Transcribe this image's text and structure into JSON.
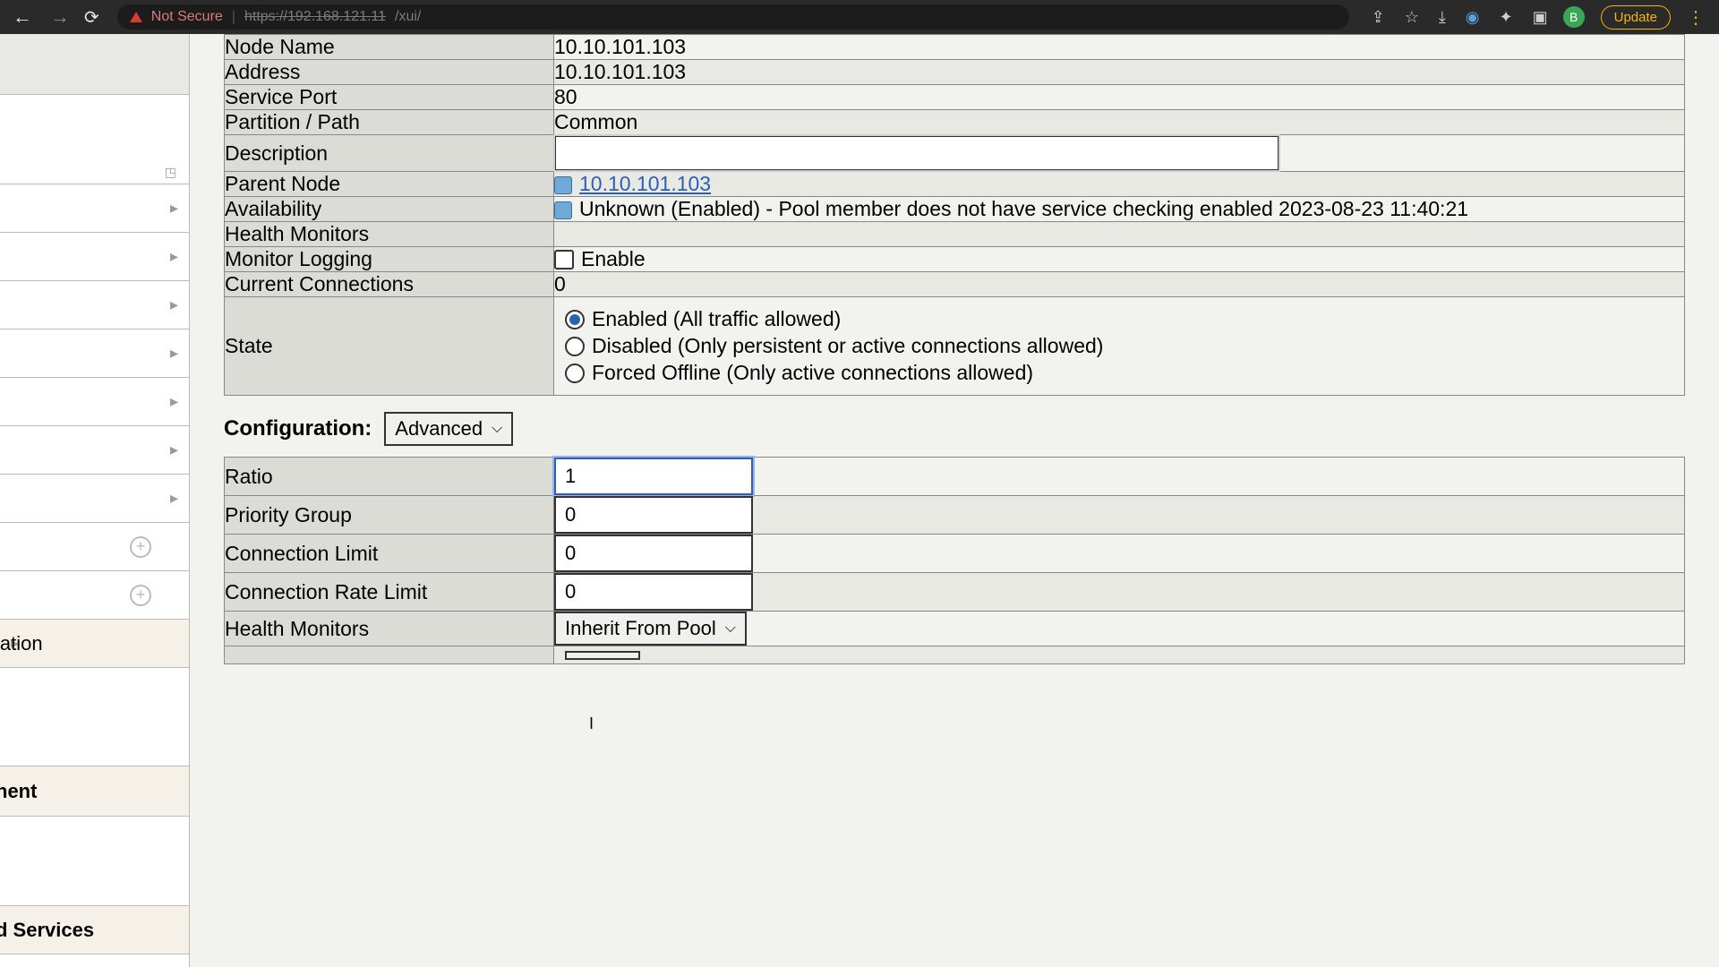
{
  "browser": {
    "not_secure": "Not Secure",
    "url_strike": "https://192.168.121.11",
    "url_path": "/xui/",
    "update": "Update",
    "avatar": "B"
  },
  "sidebar": {
    "items": [
      "",
      "",
      "",
      "",
      "",
      "",
      "",
      "",
      "",
      ""
    ],
    "frag1": "lation",
    "frag2": "nent",
    "frag3": "d Services"
  },
  "props": {
    "node_name_label": "Node Name",
    "node_name": "10.10.101.103",
    "address_label": "Address",
    "address": "10.10.101.103",
    "service_port_label": "Service Port",
    "service_port": "80",
    "partition_label": "Partition / Path",
    "partition": "Common",
    "description_label": "Description",
    "description": "",
    "parent_node_label": "Parent Node",
    "parent_node": "10.10.101.103",
    "availability_label": "Availability",
    "availability": "Unknown (Enabled) - Pool member does not have service checking enabled 2023-08-23 11:40:21",
    "health_monitors_label": "Health Monitors",
    "monitor_logging_label": "Monitor Logging",
    "monitor_logging_check": "Enable",
    "current_conn_label": "Current Connections",
    "current_conn": "0",
    "state_label": "State",
    "state_opts": {
      "enabled": "Enabled (All traffic allowed)",
      "disabled": "Disabled (Only persistent or active connections allowed)",
      "offline": "Forced Offline (Only active connections allowed)"
    }
  },
  "config": {
    "title": "Configuration:",
    "mode": "Advanced",
    "ratio_label": "Ratio",
    "ratio": "1",
    "priority_label": "Priority Group",
    "priority": "0",
    "conn_limit_label": "Connection Limit",
    "conn_limit": "0",
    "conn_rate_label": "Connection Rate Limit",
    "conn_rate": "0",
    "hm_label": "Health Monitors",
    "hm_select": "Inherit From Pool"
  }
}
